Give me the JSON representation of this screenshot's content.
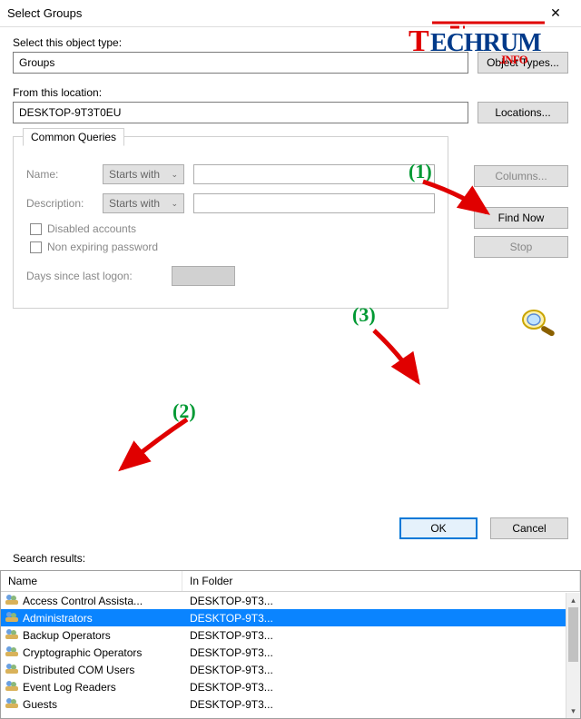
{
  "window": {
    "title": "Select Groups"
  },
  "section1": {
    "label": "Select this object type:",
    "value": "Groups",
    "button": "Object Types..."
  },
  "section2": {
    "label": "From this location:",
    "value": "DESKTOP-9T3T0EU",
    "button": "Locations..."
  },
  "queries": {
    "legend": "Common Queries",
    "name_label": "Name:",
    "name_mode": "Starts with",
    "desc_label": "Description:",
    "desc_mode": "Starts with",
    "chk_disabled": "Disabled accounts",
    "chk_nonexpire": "Non expiring password",
    "days_label": "Days since last logon:"
  },
  "sidebuttons": {
    "columns": "Columns...",
    "findnow": "Find Now",
    "stop": "Stop"
  },
  "actions": {
    "ok": "OK",
    "cancel": "Cancel"
  },
  "results": {
    "label": "Search results:",
    "col_name": "Name",
    "col_folder": "In Folder",
    "rows": [
      {
        "name": "Access Control Assista...",
        "folder": "DESKTOP-9T3...",
        "selected": false
      },
      {
        "name": "Administrators",
        "folder": "DESKTOP-9T3...",
        "selected": true
      },
      {
        "name": "Backup Operators",
        "folder": "DESKTOP-9T3...",
        "selected": false
      },
      {
        "name": "Cryptographic Operators",
        "folder": "DESKTOP-9T3...",
        "selected": false
      },
      {
        "name": "Distributed COM Users",
        "folder": "DESKTOP-9T3...",
        "selected": false
      },
      {
        "name": "Event Log Readers",
        "folder": "DESKTOP-9T3...",
        "selected": false
      },
      {
        "name": "Guests",
        "folder": "DESKTOP-9T3...",
        "selected": false
      }
    ]
  },
  "annotations": {
    "n1": "(1)",
    "n2": "(2)",
    "n3": "(3)"
  },
  "logo": {
    "t": "T",
    "rest": "ECHRUM",
    "sub": ".INFO"
  },
  "chevron": "⌄"
}
